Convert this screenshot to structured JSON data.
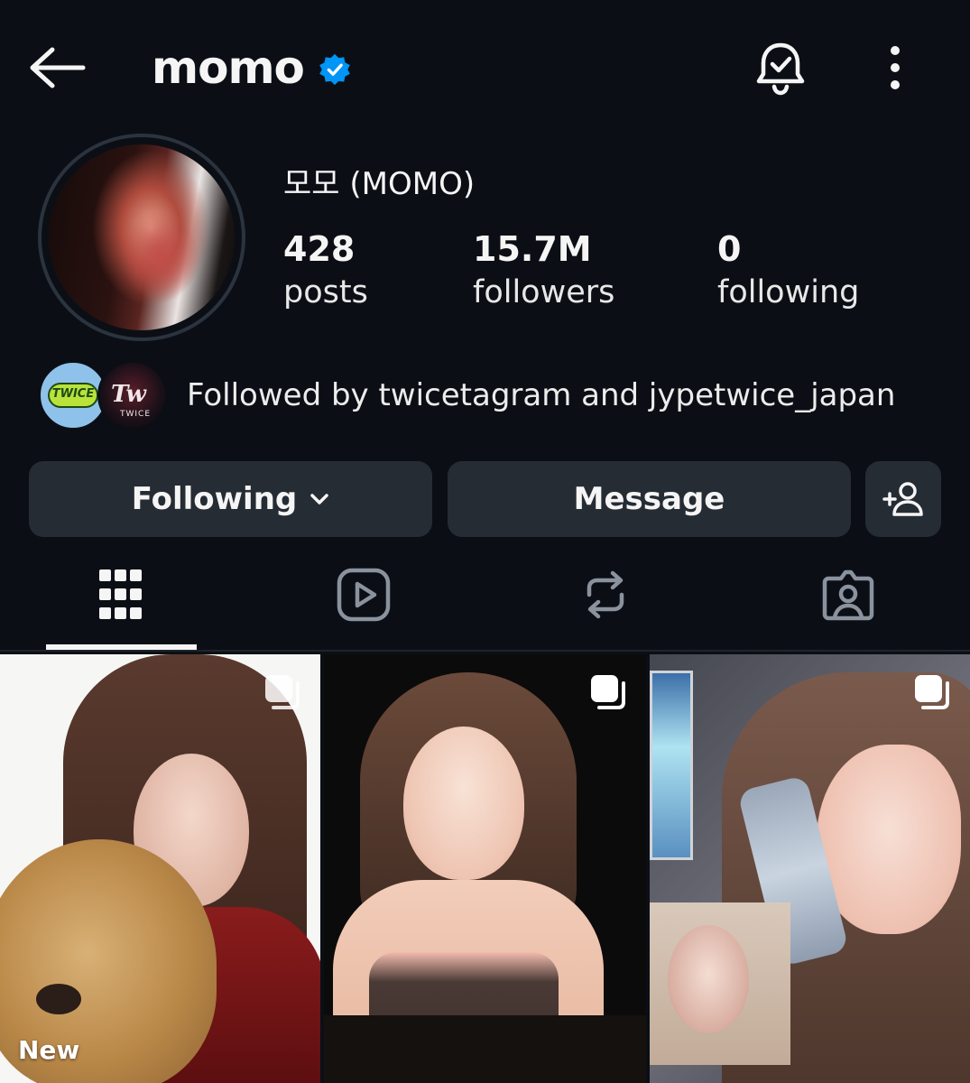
{
  "header": {
    "username": "momo",
    "verified": true,
    "icons": {
      "back": "arrow-left-icon",
      "notifications": "bell-check-icon",
      "more": "more-vertical-icon",
      "verified": "verified-badge-icon"
    }
  },
  "profile": {
    "display_name": "모모 (MOMO)",
    "stats": [
      {
        "value": "428",
        "label": "posts"
      },
      {
        "value": "15.7M",
        "label": "followers"
      },
      {
        "value": "0",
        "label": "following"
      }
    ],
    "followed_by": {
      "text": "Followed by twicetagram and jypetwice_japan",
      "avatars": [
        {
          "badge": "TWICE"
        },
        {
          "logo": "Tw",
          "sub": "TWICE"
        }
      ]
    }
  },
  "actions": {
    "following_label": "Following",
    "message_label": "Message",
    "add_icon": "add-person-icon"
  },
  "tabs": [
    {
      "icon": "grid-icon",
      "active": true
    },
    {
      "icon": "reels-icon",
      "active": false
    },
    {
      "icon": "reposts-icon",
      "active": false
    },
    {
      "icon": "tagged-icon",
      "active": false
    }
  ],
  "posts": [
    {
      "label": "New",
      "carousel": true
    },
    {
      "carousel": true
    },
    {
      "carousel": true
    }
  ],
  "colors": {
    "background": "#0b0f15",
    "button": "#262c34",
    "verified": "#0095f6",
    "text": "#f5f5f5"
  }
}
